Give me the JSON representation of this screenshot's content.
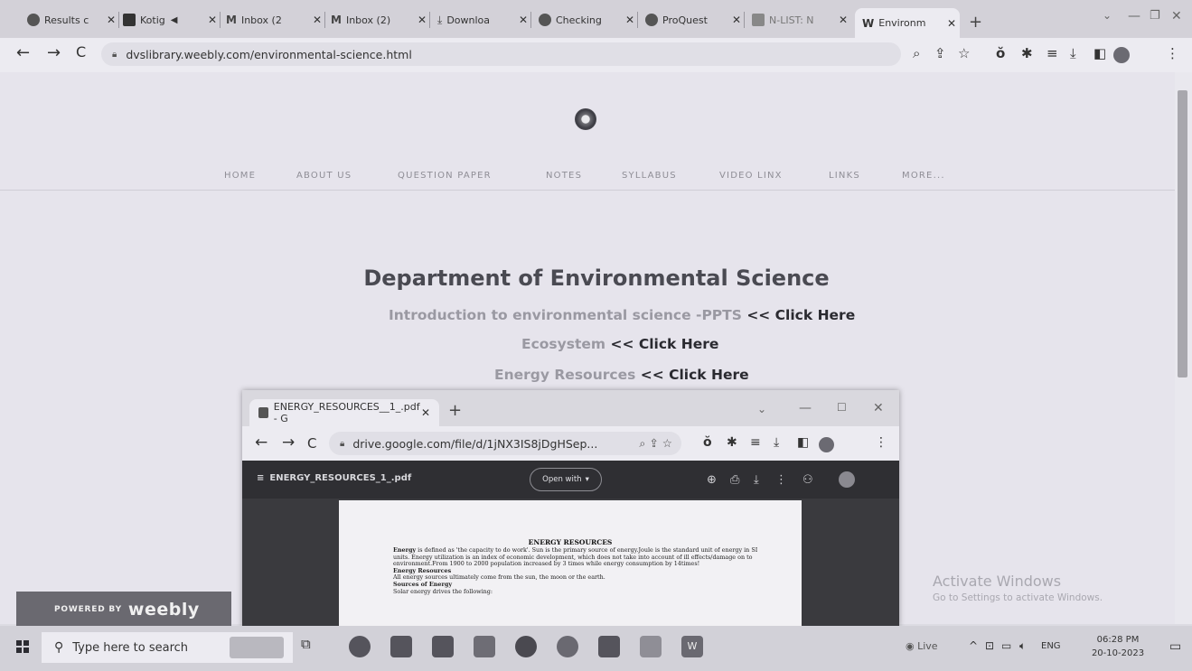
{
  "browser": {
    "tabs": [
      {
        "title": "Results c"
      },
      {
        "title": "Kotig"
      },
      {
        "title": "Inbox (2"
      },
      {
        "title": "Inbox (2)"
      },
      {
        "title": "Downloa"
      },
      {
        "title": "Checking"
      },
      {
        "title": "ProQuest"
      },
      {
        "title": "N-LIST: N"
      },
      {
        "title": "Environm",
        "active": true
      }
    ],
    "url": "dvslibrary.weebly.com/environmental-science.html"
  },
  "site": {
    "nav": [
      "HOME",
      "ABOUT US",
      "QUESTION PAPER",
      "NOTES",
      "SYLLABUS",
      "VIDEO LINX",
      "LINKS",
      "MORE..."
    ],
    "heading": "Department of Environmental Science",
    "lines": [
      {
        "text": "Introduction to environmental science -PPTS",
        "link": "<< Click Here"
      },
      {
        "text": "Ecosystem",
        "link": "<< Click Here"
      },
      {
        "text": "Energy Resources",
        "link": "<< Click Here"
      }
    ],
    "badge": {
      "powered": "POWERED BY",
      "brand": "weebly"
    }
  },
  "watermark": {
    "title": "Activate Windows",
    "subtitle": "Go to Settings to activate Windows."
  },
  "popup": {
    "tab_title": "ENERGY_RESOURCES__1_.pdf - G",
    "url": "drive.google.com/file/d/1jNX3IS8jDgHSep...",
    "viewer_title": "ENERGY_RESOURCES_1_.pdf",
    "open_with": "Open with",
    "pdf": {
      "heading": "ENERGY RESOURCES",
      "p1_bold": "Energy",
      "p1": " is defined as 'the capacity to do work'. Sun is the primary source of energy.Joule is the standard unit of energy in SI units. Energy utilization is an index of economic development, which does not take into account of ill effects/damage on to environment.From 1900 to 2000 population increased by 3 times while energy consumption by 14times!",
      "h2": "Energy Resources",
      "p2": "All energy sources ultimately come from the sun, the moon or the earth.",
      "h3": "Sources of Energy",
      "p3": "Solar energy drives the following:"
    }
  },
  "taskbar": {
    "search_placeholder": "Type here to search",
    "tray_live": "Live",
    "lang": "ENG",
    "time": "06:28 PM",
    "date": "20-10-2023"
  }
}
